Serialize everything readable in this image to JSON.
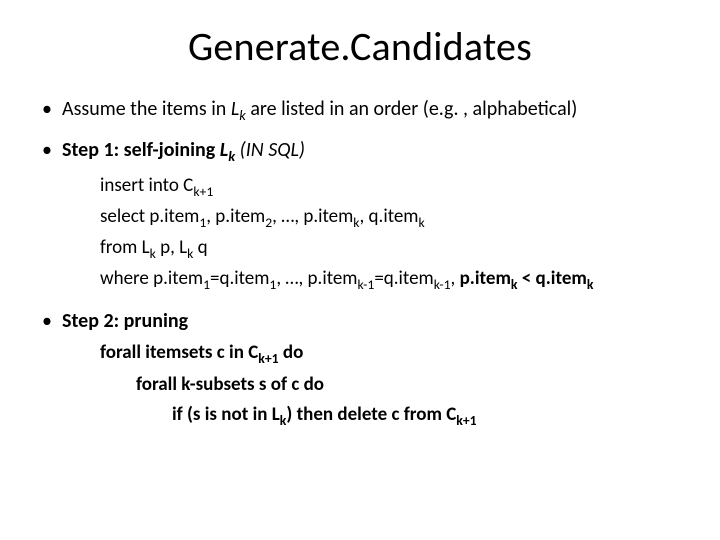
{
  "title": "Generate.Candidates",
  "bullets": {
    "b1": {
      "pre": "Assume the items in ",
      "lk": "L",
      "lk_sub": "k",
      "post": " are listed in an order (e.g. , alphabetical)"
    },
    "b2": {
      "label": "Step 1: self-joining ",
      "lk": "L",
      "lk_sub": "k",
      "trail": " (IN SQL)"
    },
    "b3": {
      "label": "Step 2: pruning"
    }
  },
  "sql": {
    "insert_pre": "insert into C",
    "insert_sub": "k+1",
    "select_a": "select p.item",
    "s1": "1",
    "select_b": ", p.item",
    "s2": "2",
    "select_c": ", …, p.item",
    "sk": "k",
    "select_d": ", q.item",
    "from_a": "from L",
    "from_b": " p, L",
    "from_c": " q",
    "where_a": "where p.item",
    "where_b": "=q.item",
    "where_c": ", …, p.item",
    "skm1": "k-1",
    "where_d": "=q.item",
    "where_e": ", ",
    "where_bold_a": "p.item",
    "where_bold_mid": " < q.item"
  },
  "prune": {
    "l1_a": "forall itemsets c in C",
    "l1_sub": "k+1",
    "l1_b": " do",
    "l2": "forall k-subsets s of c do",
    "l3_a": "if (s is not in L",
    "l3_sub": "k",
    "l3_b": ") then delete c from C",
    "l3_sub2": "k+1"
  }
}
